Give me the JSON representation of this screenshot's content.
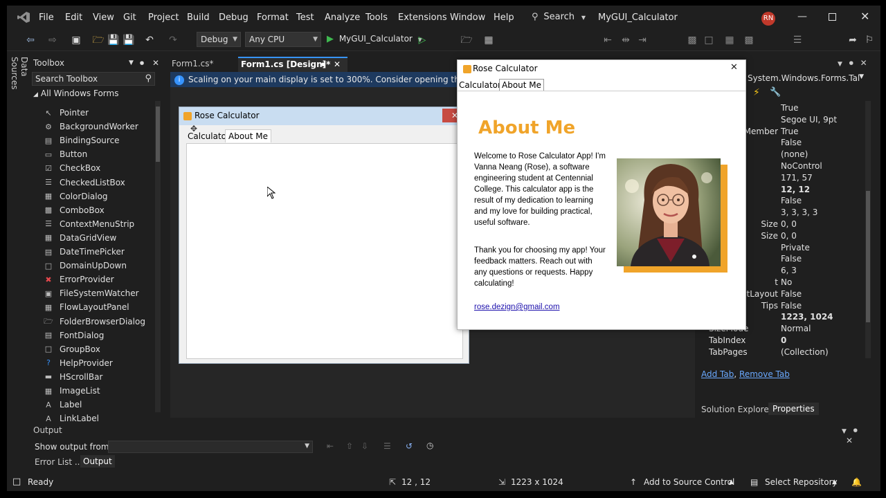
{
  "menubar": {
    "items": [
      "File",
      "Edit",
      "View",
      "Git",
      "Project",
      "Build",
      "Debug",
      "Format",
      "Test",
      "Analyze",
      "Tools",
      "Extensions",
      "Window",
      "Help"
    ],
    "search_label": "Search",
    "solution_name": "MyGUI_Calculator",
    "user_initials": "RN"
  },
  "toolbar": {
    "config": "Debug",
    "platform": "Any CPU",
    "start_label": "MyGUI_Calculator"
  },
  "side_tabs": {
    "data_sources": "Data Sources"
  },
  "toolbox": {
    "title": "Toolbox",
    "search_placeholder": "Search Toolbox",
    "group": "All Windows Forms",
    "items": [
      "Pointer",
      "BackgroundWorker",
      "BindingSource",
      "Button",
      "CheckBox",
      "CheckedListBox",
      "ColorDialog",
      "ComboBox",
      "ContextMenuStrip",
      "DataGridView",
      "DateTimePicker",
      "DomainUpDown",
      "ErrorProvider",
      "FileSystemWatcher",
      "FlowLayoutPanel",
      "FolderBrowserDialog",
      "FontDialog",
      "GroupBox",
      "HelpProvider",
      "HScrollBar",
      "ImageList",
      "Label",
      "LinkLabel"
    ]
  },
  "doc_tabs": {
    "tab1": "Form1.cs*",
    "tab2": "Form1.cs [Design]*"
  },
  "info_bar": {
    "message": "Scaling on your main display is set to 300%. Consider opening the WinForms"
  },
  "designer": {
    "form_title": "Rose Calculator",
    "tab1": "Calculator",
    "tab2": "About Me"
  },
  "properties": {
    "object": "System.Windows.Forms.Tal",
    "rows": [
      {
        "name": "",
        "value": "True"
      },
      {
        "name": "",
        "value": "Segoe UI, 9pt"
      },
      {
        "name": "Member",
        "value": "True"
      },
      {
        "name": "",
        "value": "False"
      },
      {
        "name": "",
        "value": "(none)"
      },
      {
        "name": "",
        "value": "NoControl"
      },
      {
        "name": "",
        "value": "171, 57"
      },
      {
        "name": "",
        "value": "12, 12"
      },
      {
        "name": "",
        "value": "False"
      },
      {
        "name": "",
        "value": "3, 3, 3, 3"
      },
      {
        "name": "Size",
        "value": "0, 0"
      },
      {
        "name": "Size",
        "value": "0, 0"
      },
      {
        "name": "",
        "value": "Private"
      },
      {
        "name": "",
        "value": "False"
      },
      {
        "name": "",
        "value": "6, 3"
      },
      {
        "name": "t",
        "value": "No"
      },
      {
        "name": "tLayout",
        "value": "False"
      },
      {
        "name": "Tips",
        "value": "False"
      },
      {
        "name": "",
        "value": "1223, 1024"
      },
      {
        "name": "SizeMode",
        "value": "Normal"
      },
      {
        "name": "TabIndex",
        "value": "0"
      },
      {
        "name": "TabPages",
        "value": "(Collection)"
      }
    ],
    "add_tab": "Add Tab",
    "remove_tab": "Remove Tab",
    "solution_explorer_tab": "Solution Explorer",
    "properties_tab": "Properties"
  },
  "output": {
    "title": "Output",
    "show_from": "Show output from:",
    "error_list_tab": "Error List ...",
    "output_tab": "Output"
  },
  "status": {
    "ready": "Ready",
    "position": "12 , 12",
    "size": "1223 x 1024",
    "add_source": "Add to Source Control",
    "select_repo": "Select Repository"
  },
  "running_app": {
    "title": "Rose Calculator",
    "tab1": "Calculator",
    "tab2": "About Me",
    "heading": "About Me",
    "para1": "Welcome to Rose Calculator App! I'm Vanna Neang (Rose), a software engineering student at Centennial College. This calculator app is the result of my dedication to learning and my love for building practical, useful software.",
    "para2": "Thank you for choosing my app! Your feedback matters. Reach out with any questions or requests. Happy calculating!",
    "email": "rose.dezign@gmail.com",
    "accent_color": "#f0a42a"
  },
  "colors": {
    "ide_bg": "#1f1f1f",
    "accent_blue": "#3794ff",
    "info_bar": "#1e3a5f"
  }
}
